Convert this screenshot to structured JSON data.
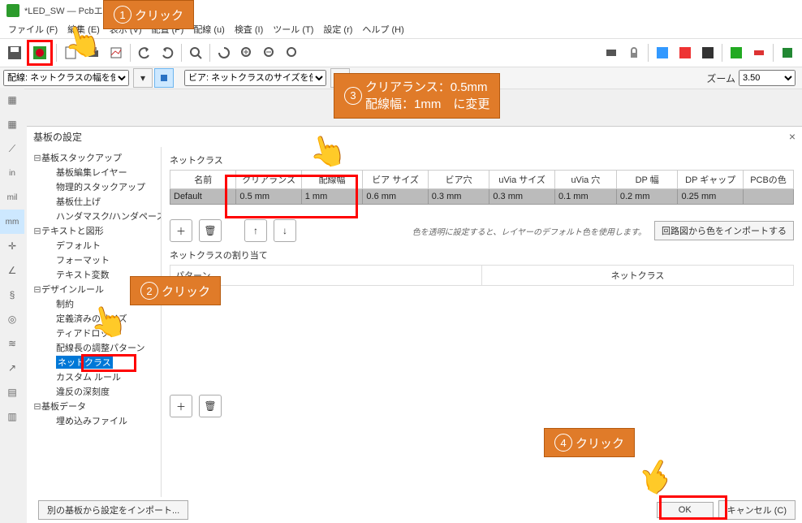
{
  "window": {
    "title": "*LED_SW — Pcbエディター"
  },
  "menu": [
    "ファイル (F)",
    "編集 (E)",
    "表示 (V)",
    "配置 (P)",
    "配線 (u)",
    "検査 (I)",
    "ツール (T)",
    "設定 (r)",
    "ヘルプ (H)"
  ],
  "selectors": {
    "track": "配線: ネットクラスの幅を使用",
    "via": "ビア: ネットクラスのサイズを使用",
    "zoom_label": "ズーム",
    "zoom_value": "3.50"
  },
  "dialog": {
    "title": "基板の設定",
    "close": "×",
    "tree": {
      "stackup": "基板スタックアップ",
      "stackup_items": [
        "基板編集レイヤー",
        "物理的スタックアップ",
        "基板仕上げ",
        "ハンダマスク/ハンダペースト"
      ],
      "text": "テキストと図形",
      "text_items": [
        "デフォルト",
        "フォーマット",
        "テキスト変数"
      ],
      "rules": "デザインルール",
      "rules_items": [
        "制約",
        "定義済みのサイズ",
        "ティアドロップ",
        "配線長の調整パターン",
        "ネットクラス",
        "カスタム ルール",
        "違反の深刻度"
      ],
      "data": "基板データ",
      "data_items": [
        "埋め込みファイル"
      ]
    },
    "netclass": {
      "label": "ネットクラス",
      "cols": [
        "名前",
        "クリアランス",
        "配線幅",
        "ビア サイズ",
        "ビア穴",
        "uVia サイズ",
        "uVia 穴",
        "DP 幅",
        "DP ギャップ",
        "PCBの色"
      ],
      "row": [
        "Default",
        "0.5 mm",
        "1 mm",
        "0.6 mm",
        "0.3 mm",
        "0.3 mm",
        "0.1 mm",
        "0.2 mm",
        "0.25 mm",
        ""
      ],
      "hint": "色を透明に設定すると、レイヤーのデフォルト色を使用します。",
      "import": "回路図から色をインポートする"
    },
    "assign": {
      "label": "ネットクラスの割り当て",
      "col1": "パターン",
      "col2": "ネットクラス"
    },
    "footer": {
      "import_other": "別の基板から設定をインポート...",
      "ok": "OK",
      "cancel": "キャンセル (C)"
    }
  },
  "callouts": {
    "c1": "クリック",
    "c2": "クリック",
    "c3_l1": "クリアランス：0.5mm",
    "c3_l2": "配線幅：1mm　に変更",
    "c4": "クリック"
  }
}
